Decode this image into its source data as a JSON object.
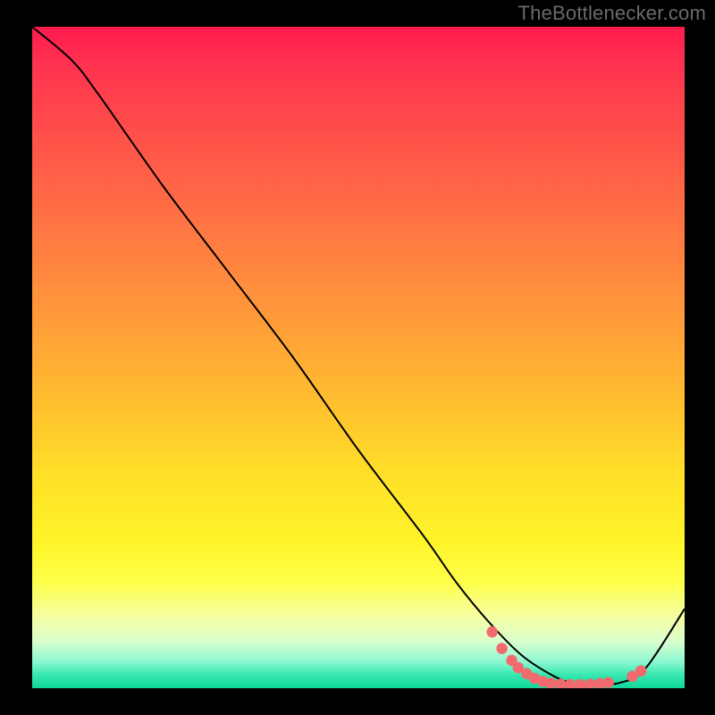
{
  "attribution": "TheBottlenecker.com",
  "chart_data": {
    "type": "line",
    "title": "",
    "xlabel": "",
    "ylabel": "",
    "xlim": [
      0,
      100
    ],
    "ylim": [
      0,
      100
    ],
    "series": [
      {
        "name": "curve",
        "x": [
          0,
          6,
          10,
          20,
          30,
          40,
          50,
          60,
          65,
          70,
          75,
          80,
          83,
          86,
          90,
          94,
          100
        ],
        "y": [
          100,
          95,
          90,
          76,
          63,
          50,
          36,
          23,
          16,
          10,
          5,
          1.8,
          0.8,
          0.6,
          0.8,
          3,
          12
        ]
      }
    ],
    "markers": {
      "name": "dots",
      "color": "#f26a6e",
      "points": [
        {
          "x": 70.5,
          "y": 8.5
        },
        {
          "x": 72,
          "y": 6
        },
        {
          "x": 73.5,
          "y": 4.2
        },
        {
          "x": 74.5,
          "y": 3.1
        },
        {
          "x": 75.8,
          "y": 2.2
        },
        {
          "x": 77,
          "y": 1.5
        },
        {
          "x": 78.3,
          "y": 1.0
        },
        {
          "x": 79.5,
          "y": 0.75
        },
        {
          "x": 81,
          "y": 0.6
        },
        {
          "x": 82.5,
          "y": 0.55
        },
        {
          "x": 84,
          "y": 0.55
        },
        {
          "x": 85.5,
          "y": 0.6
        },
        {
          "x": 87,
          "y": 0.7
        },
        {
          "x": 88.3,
          "y": 0.85
        },
        {
          "x": 92,
          "y": 1.8
        },
        {
          "x": 93.3,
          "y": 2.6
        }
      ]
    }
  }
}
